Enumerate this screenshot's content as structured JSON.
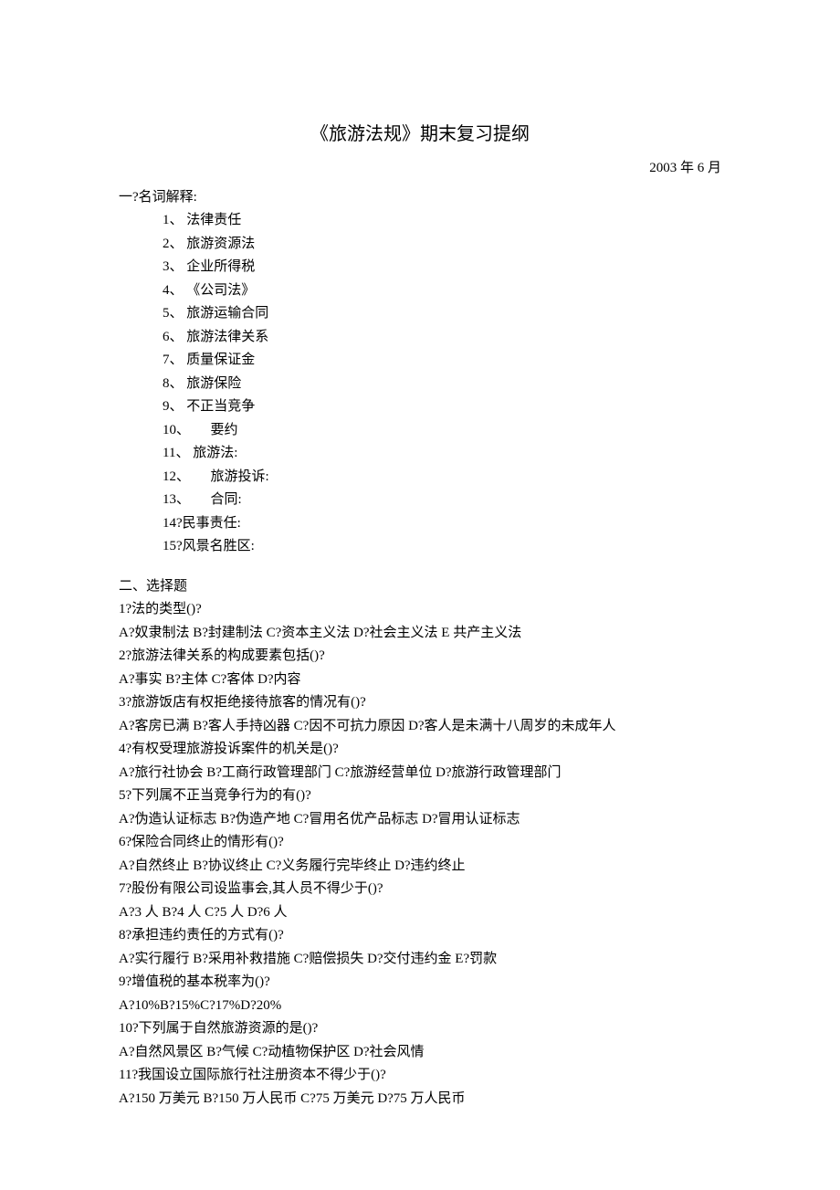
{
  "title": "《旅游法规》期末复习提纲",
  "date": "2003 年 6 月",
  "section1": {
    "heading": "一?名词解释:",
    "items": [
      "1、 法律责任",
      "2、 旅游资源法",
      "3、 企业所得税",
      "4、 《公司法》",
      "5、 旅游运输合同",
      "6、 旅游法律关系",
      "7、 质量保证金",
      "8、 旅游保险",
      "9、 不正当竞争",
      "10、　　要约",
      "11、 旅游法:",
      "12、　　旅游投诉:",
      "13、　　合同:",
      "14?民事责任:",
      "15?风景名胜区:"
    ]
  },
  "section2": {
    "heading": "二、选择题",
    "lines": [
      "1?法的类型()?",
      "A?奴隶制法 B?封建制法 C?资本主义法 D?社会主义法 E 共产主义法",
      "2?旅游法律关系的构成要素包括()?",
      "A?事实 B?主体 C?客体 D?内容",
      "3?旅游饭店有权拒绝接待旅客的情况有()?",
      "A?客房已满 B?客人手持凶器 C?因不可抗力原因 D?客人是未满十八周岁的未成年人",
      "4?有权受理旅游投诉案件的机关是()?",
      "A?旅行社协会 B?工商行政管理部门 C?旅游经营单位 D?旅游行政管理部门",
      "5?下列属不正当竞争行为的有()?",
      "A?伪造认证标志 B?伪造产地 C?冒用名优产品标志 D?冒用认证标志",
      "6?保险合同终止的情形有()?",
      "A?自然终止 B?协议终止 C?义务履行完毕终止 D?违约终止",
      "7?股份有限公司设监事会,其人员不得少于()?",
      "A?3 人 B?4 人 C?5 人 D?6 人",
      "8?承担违约责任的方式有()?",
      "A?实行履行 B?采用补救措施 C?赔偿损失 D?交付违约金 E?罚款",
      "9?增值税的基本税率为()?",
      "A?10%B?15%C?17%D?20%",
      "10?下列属于自然旅游资源的是()?",
      "A?自然风景区 B?气候 C?动植物保护区 D?社会风情",
      "11?我国设立国际旅行社注册资本不得少于()?",
      "A?150 万美元 B?150 万人民币 C?75 万美元 D?75 万人民币"
    ]
  }
}
